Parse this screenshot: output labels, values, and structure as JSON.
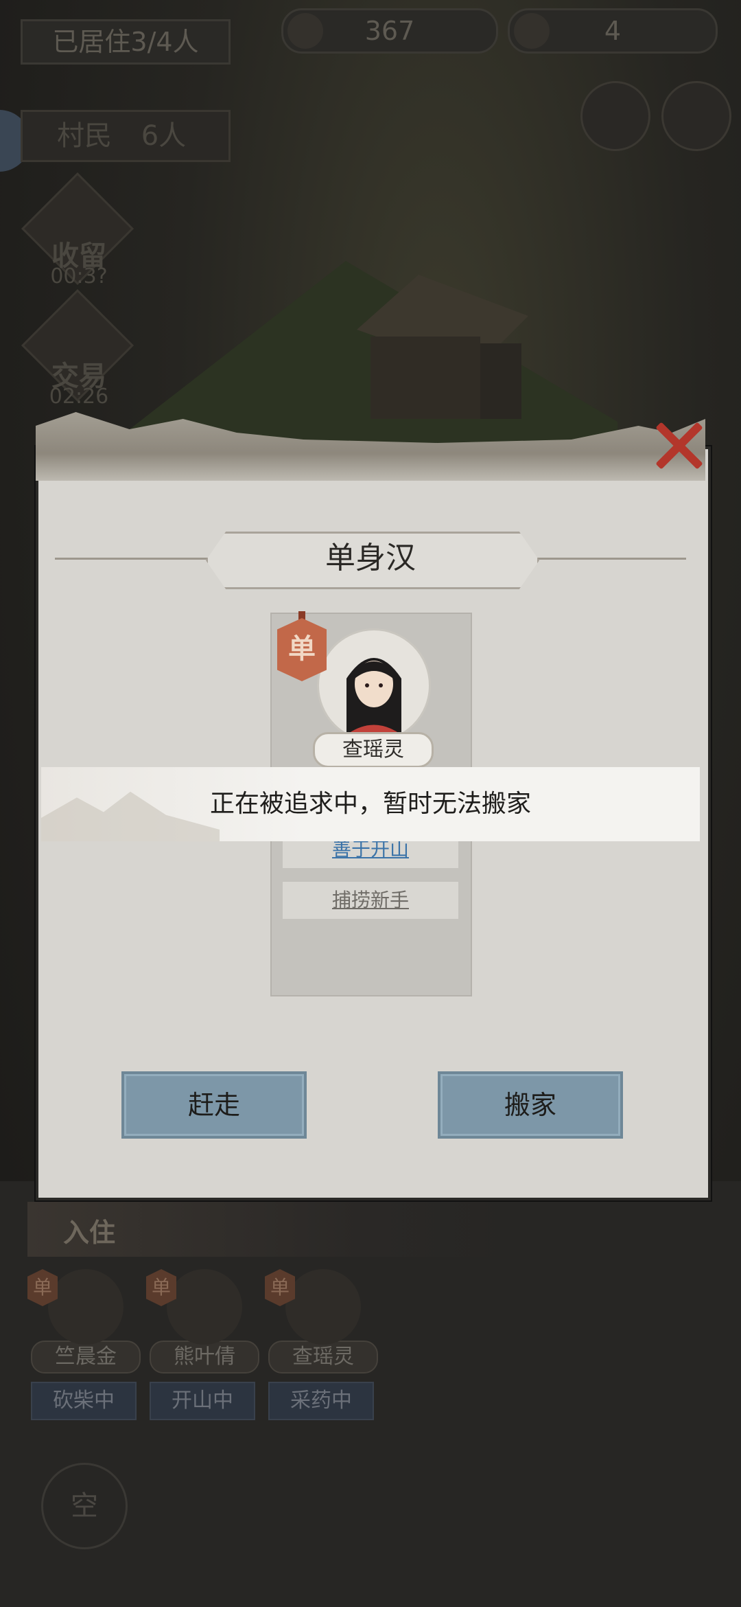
{
  "topbar": {
    "residents_label": "已居住3/4人",
    "coins_value": "367",
    "gems_value": "4"
  },
  "left_panel": {
    "villagers_label": "村民",
    "villagers_count": "6人",
    "shelter_label": "收留",
    "shelter_timer": "00:3?",
    "trade_label": "交易",
    "trade_timer": "02:26"
  },
  "dialog": {
    "title": "单身汉",
    "badge_char": "单",
    "character_name": "查瑶灵",
    "traits": [
      "善于开山",
      "捕捞新手"
    ],
    "toast_message": "正在被追求中，暂时无法搬家",
    "evict_label": "赶走",
    "move_label": "搬家"
  },
  "bottom": {
    "section_label": "入住",
    "residents": [
      {
        "name": "竺晨金",
        "status": "砍柴中",
        "badge": "单"
      },
      {
        "name": "熊叶倩",
        "status": "开山中",
        "badge": "单"
      },
      {
        "name": "查瑶灵",
        "status": "采药中",
        "badge": "单"
      }
    ],
    "empty_slot_label": "空"
  },
  "colors": {
    "accent_red": "#b3362b",
    "button_blue": "#7d97a8",
    "badge_orange": "#c26849",
    "trait_link": "#3b73a8"
  },
  "icons": [
    "coin-icon",
    "gem-icon",
    "chat-icon",
    "scroll-icon",
    "settings-icon",
    "close-icon"
  ]
}
